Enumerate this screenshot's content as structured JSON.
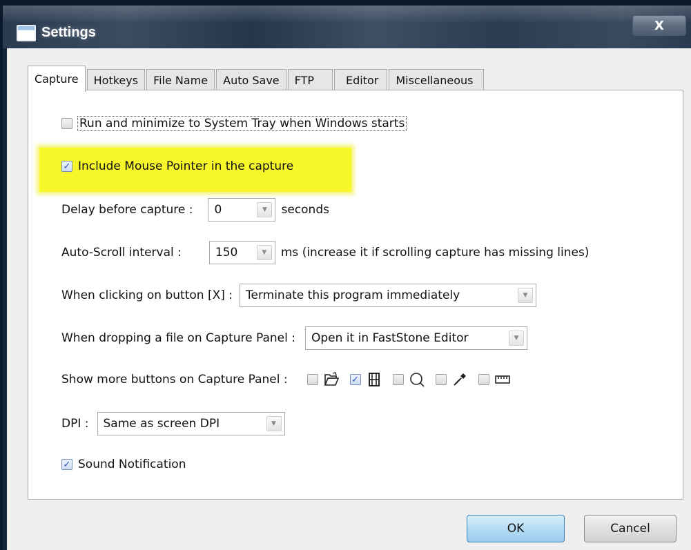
{
  "window": {
    "title": "Settings",
    "close_label": "X"
  },
  "tabs": [
    {
      "label": "Capture",
      "active": true
    },
    {
      "label": "Hotkeys"
    },
    {
      "label": "File Name"
    },
    {
      "label": "Auto Save"
    },
    {
      "label": "FTP"
    },
    {
      "label": "Editor"
    },
    {
      "label": "Miscellaneous"
    }
  ],
  "capture": {
    "run_minimize": {
      "label": "Run and minimize to System Tray when Windows starts",
      "checked": false
    },
    "include_pointer": {
      "label": "Include Mouse Pointer in the capture",
      "checked": true
    },
    "delay": {
      "label": "Delay before capture :",
      "value": "0",
      "unit": "seconds"
    },
    "auto_scroll": {
      "label": "Auto-Scroll interval :",
      "value": "150",
      "unit": "ms (increase it if scrolling capture has missing lines)"
    },
    "click_x": {
      "label": "When clicking on button [X] :",
      "value": "Terminate this program immediately"
    },
    "drop_file": {
      "label": "When dropping a file on Capture Panel :",
      "value": "Open it in FastStone Editor"
    },
    "more_buttons": {
      "label": "Show more buttons on Capture Panel :",
      "items": [
        {
          "icon": "open-folder-icon",
          "checked": false
        },
        {
          "icon": "film-strip-icon",
          "checked": true
        },
        {
          "icon": "magnifier-icon",
          "checked": false
        },
        {
          "icon": "color-picker-icon",
          "checked": false
        },
        {
          "icon": "ruler-icon",
          "checked": false
        }
      ]
    },
    "dpi": {
      "label": "DPI :",
      "value": "Same as screen DPI"
    },
    "sound": {
      "label": "Sound Notification",
      "checked": true
    }
  },
  "buttons": {
    "ok": "OK",
    "cancel": "Cancel"
  },
  "colors": {
    "highlight": "#f7f72a",
    "ok_button": "#b6dcf4"
  }
}
